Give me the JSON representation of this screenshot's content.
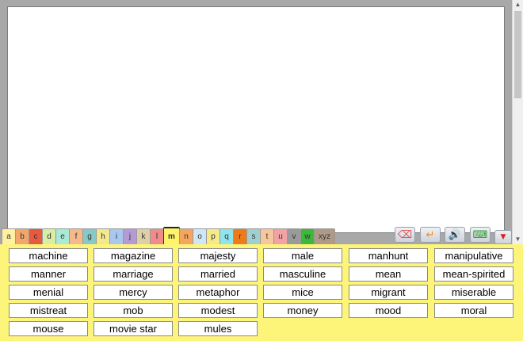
{
  "letter_tabs": [
    {
      "label": "a",
      "color": "#fff1a0"
    },
    {
      "label": "b",
      "color": "#f4a66a"
    },
    {
      "label": "c",
      "color": "#e85a3d"
    },
    {
      "label": "d",
      "color": "#d9eda3"
    },
    {
      "label": "e",
      "color": "#a8ead6"
    },
    {
      "label": "f",
      "color": "#f7b88a"
    },
    {
      "label": "g",
      "color": "#86c9c9"
    },
    {
      "label": "h",
      "color": "#f4e88c"
    },
    {
      "label": "i",
      "color": "#a9c8ee"
    },
    {
      "label": "j",
      "color": "#b69ad6"
    },
    {
      "label": "k",
      "color": "#ded0a6"
    },
    {
      "label": "l",
      "color": "#f18a8a"
    },
    {
      "label": "m",
      "color": "#fff36a"
    },
    {
      "label": "n",
      "color": "#f6a55e"
    },
    {
      "label": "o",
      "color": "#cfe6f4"
    },
    {
      "label": "p",
      "color": "#f6e98a"
    },
    {
      "label": "q",
      "color": "#8fe4ee"
    },
    {
      "label": "r",
      "color": "#ef7a18"
    },
    {
      "label": "s",
      "color": "#9fd0cf"
    },
    {
      "label": "t",
      "color": "#f5c79a"
    },
    {
      "label": "u",
      "color": "#f3a2a4"
    },
    {
      "label": "v",
      "color": "#9a9a9a"
    },
    {
      "label": "w",
      "color": "#3eb83a"
    },
    {
      "label": "xyz",
      "color": "#b09a86"
    }
  ],
  "active_tab": "m",
  "tools": [
    {
      "name": "backspace-icon",
      "symbol": "⌫",
      "color": "#e05050"
    },
    {
      "name": "enter-icon",
      "symbol": "↵",
      "color": "#f28a1a"
    },
    {
      "name": "speaker-icon",
      "symbol": "🔊",
      "color": "#4a7ec0"
    },
    {
      "name": "keyboard-icon",
      "symbol": "⌨",
      "color": "#2a9a2a"
    },
    {
      "name": "collapse-icon",
      "symbol": "▼",
      "color": "#e02020"
    }
  ],
  "words": [
    "machine",
    "magazine",
    "majesty",
    "male",
    "manhunt",
    "manipulative",
    "manner",
    "marriage",
    "married",
    "masculine",
    "mean",
    "mean-spirited",
    "menial",
    "mercy",
    "metaphor",
    "mice",
    "migrant",
    "miserable",
    "mistreat",
    "mob",
    "modest",
    "money",
    "mood",
    "moral",
    "mouse",
    "movie star",
    "mules"
  ]
}
